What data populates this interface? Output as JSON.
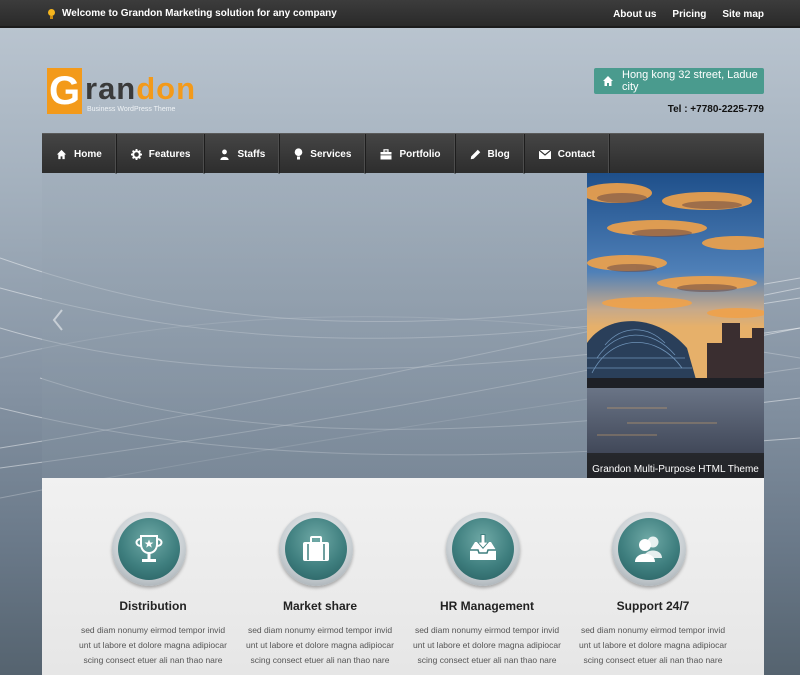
{
  "topbar": {
    "welcome": "Welcome to Grandon Marketing solution for any company",
    "links": [
      "About us",
      "Pricing",
      "Site map"
    ]
  },
  "logo": {
    "initial": "G",
    "part1": "ran",
    "part2": "don",
    "tagline": "Business WordPress Theme"
  },
  "contact": {
    "address": "Hong kong 32 street, Ladue city",
    "tel": "Tel : +7780-2225-779"
  },
  "nav": [
    {
      "label": "Home",
      "icon": "home-icon"
    },
    {
      "label": "Features",
      "icon": "gear-icon"
    },
    {
      "label": "Staffs",
      "icon": "user-icon"
    },
    {
      "label": "Services",
      "icon": "bulb-icon"
    },
    {
      "label": "Portfolio",
      "icon": "briefcase-icon"
    },
    {
      "label": "Blog",
      "icon": "pencil-icon"
    },
    {
      "label": "Contact",
      "icon": "envelope-icon"
    }
  ],
  "slider": {
    "caption": "Grandon Multi-Purpose HTML Theme"
  },
  "features": [
    {
      "title": "Distribution",
      "icon": "trophy-icon",
      "desc": [
        "sed diam nonumy eirmod tempor invid",
        "unt ut labore et dolore magna adipiocar",
        "scing consect etuer ali nan thao nare"
      ]
    },
    {
      "title": "Market share",
      "icon": "briefcase-icon",
      "desc": [
        "sed diam nonumy eirmod tempor invid",
        "unt ut labore et dolore magna adipiocar",
        "scing consect etuer ali nan thao nare"
      ]
    },
    {
      "title": "HR Management",
      "icon": "inbox-download-icon",
      "desc": [
        "sed diam nonumy eirmod tempor invid",
        "unt ut labore et dolore magna adipiocar",
        "scing consect etuer ali nan thao nare"
      ]
    },
    {
      "title": "Support 24/7",
      "icon": "users-icon",
      "desc": [
        "sed diam nonumy eirmod tempor invid",
        "unt ut labore et dolore magna adipiocar",
        "scing consect etuer ali nan thao nare"
      ]
    }
  ],
  "colors": {
    "accent": "#f39a1a",
    "teal": "#4a9b8e",
    "nav_bg": "#353535"
  }
}
